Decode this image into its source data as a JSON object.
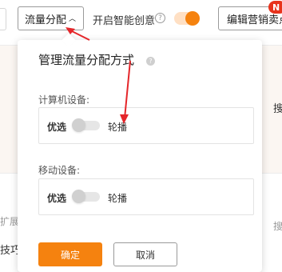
{
  "toolbar": {
    "flow_dropdown_label": "流量分配",
    "smart_creative_label": "开启智能创意",
    "smart_creative_help": "?",
    "smart_creative_enabled": true,
    "edit_button_label": "编辑营销卖点",
    "new_badge": "N"
  },
  "popover": {
    "title": "管理流量分配方式",
    "help": "?",
    "sections": [
      {
        "label": "计算机设备:",
        "left_option": "优选",
        "right_option": "轮播"
      },
      {
        "label": "移动设备:",
        "left_option": "优选",
        "right_option": "轮播"
      }
    ],
    "confirm_label": "确定",
    "cancel_label": "取消"
  },
  "background": {
    "left_text_1": "扩展项",
    "left_text_2": "技巧",
    "right_text_1": "搜",
    "right_text_2": "搜"
  },
  "colors": {
    "accent": "#f5820f",
    "annotation": "#e5262a"
  }
}
